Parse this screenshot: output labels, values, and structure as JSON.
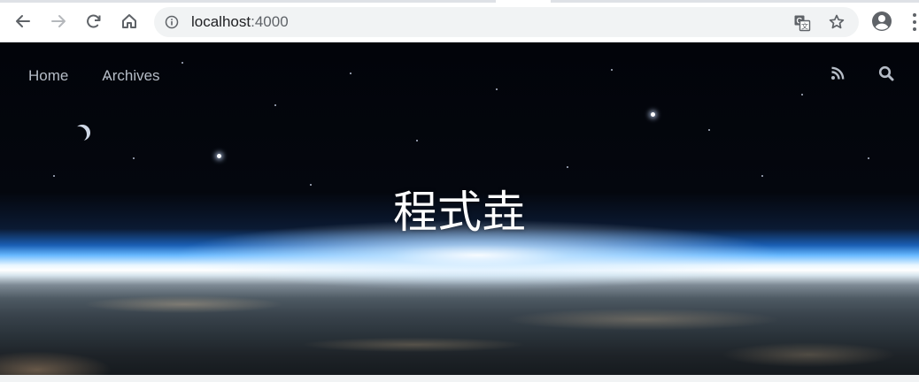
{
  "browser": {
    "url_host": "localhost",
    "url_port": ":4000"
  },
  "site": {
    "nav": {
      "home": "Home",
      "archives": "Archives"
    },
    "title": "程式垚"
  },
  "icons": {
    "back": "back-arrow-icon",
    "forward": "forward-arrow-icon",
    "reload": "reload-icon",
    "home": "home-icon",
    "info": "info-icon",
    "translate": "translate-icon",
    "bookmark": "star-icon",
    "profile": "profile-icon",
    "menu": "kebab-menu-icon",
    "rss": "rss-icon",
    "search": "search-icon"
  },
  "colors": {
    "toolbar_bg": "#ffffff",
    "omnibox_bg": "#f1f3f4",
    "nav_link": "#b5bcc6",
    "title": "#ffffff"
  }
}
